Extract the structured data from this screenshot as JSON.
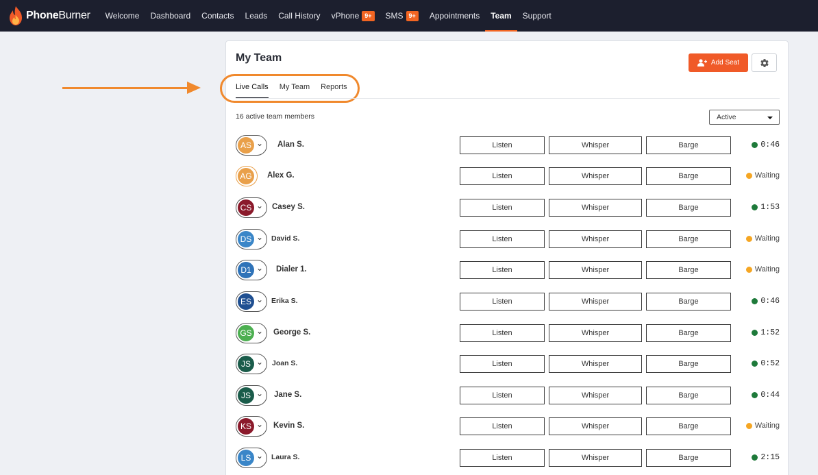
{
  "brand": {
    "name_bold": "Phone",
    "name_rest": "Burner"
  },
  "nav": [
    {
      "label": "Welcome"
    },
    {
      "label": "Dashboard"
    },
    {
      "label": "Contacts"
    },
    {
      "label": "Leads"
    },
    {
      "label": "Call History"
    },
    {
      "label": "vPhone",
      "badge": "9+"
    },
    {
      "label": "SMS",
      "badge": "9+"
    },
    {
      "label": "Appointments"
    },
    {
      "label": "Team",
      "active": true
    },
    {
      "label": "Support"
    }
  ],
  "page": {
    "title": "My Team",
    "add_seat_label": "Add Seat",
    "tabs": [
      "Live Calls",
      "My Team",
      "Reports"
    ],
    "active_tab": "Live Calls",
    "active_count": "16 active team members",
    "filter_value": "Active"
  },
  "action_labels": {
    "listen": "Listen",
    "whisper": "Whisper",
    "barge": "Barge"
  },
  "colors": {
    "accent": "#f26522",
    "live": "#1e7a3a",
    "waiting": "#f5a623",
    "annotation": "#f0892d"
  },
  "members": [
    {
      "initials": "AS",
      "name": "Alan S.",
      "avatar_color": "#e9a04a",
      "caret": true,
      "status": "live",
      "time": "0:46"
    },
    {
      "initials": "AG",
      "name": "Alex G.",
      "avatar_color": "#e9a04a",
      "caret": false,
      "status": "waiting",
      "time": "Waiting"
    },
    {
      "initials": "CS",
      "name": "Casey S.",
      "avatar_color": "#8b1a2b",
      "caret": true,
      "status": "live",
      "time": "1:53"
    },
    {
      "initials": "DS",
      "name": "David S.",
      "avatar_color": "#3a86c8",
      "caret": true,
      "status": "waiting",
      "time": "Waiting"
    },
    {
      "initials": "D1",
      "name": "Dialer 1.",
      "avatar_color": "#2f73b8",
      "caret": true,
      "status": "waiting",
      "time": "Waiting"
    },
    {
      "initials": "ES",
      "name": "Erika S.",
      "avatar_color": "#1f4f91",
      "caret": true,
      "status": "live",
      "time": "0:46"
    },
    {
      "initials": "GS",
      "name": "George S.",
      "avatar_color": "#4caf50",
      "caret": true,
      "status": "live",
      "time": "1:52"
    },
    {
      "initials": "JS",
      "name": "Joan S.",
      "avatar_color": "#1a5c4a",
      "caret": true,
      "status": "live",
      "time": "0:52"
    },
    {
      "initials": "JS",
      "name": "Jane S.",
      "avatar_color": "#1a5c4a",
      "caret": true,
      "status": "live",
      "time": "0:44"
    },
    {
      "initials": "KS",
      "name": "Kevin S.",
      "avatar_color": "#8b1a2b",
      "caret": true,
      "status": "waiting",
      "time": "Waiting"
    },
    {
      "initials": "LS",
      "name": "Laura S.",
      "avatar_color": "#3a86c8",
      "caret": true,
      "status": "live",
      "time": "2:15"
    }
  ]
}
